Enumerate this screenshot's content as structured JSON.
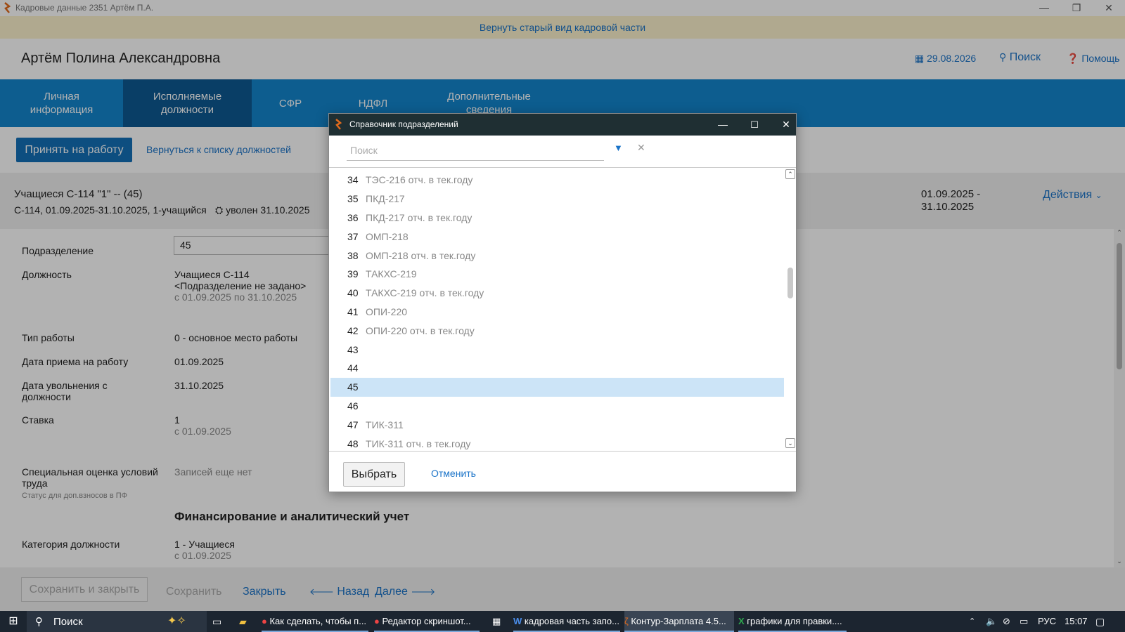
{
  "window": {
    "title": "Кадровые данные  2351  Артём П.А."
  },
  "banner": {
    "text": "Вернуть старый вид кадровой части"
  },
  "header": {
    "person_name": "Артём Полина Александровна",
    "date": "29.08.2026",
    "search": "Поиск",
    "help": "Помощь"
  },
  "tabs": [
    {
      "label_line1": "Личная",
      "label_line2": "информация"
    },
    {
      "label_line1": "Исполняемые",
      "label_line2": "должности"
    },
    {
      "label_line1": "СФР",
      "label_line2": ""
    },
    {
      "label_line1": "НДФЛ",
      "label_line2": ""
    },
    {
      "label_line1": "Дополнительные",
      "label_line2": "сведения"
    }
  ],
  "actions": {
    "hire": "Принять на работу",
    "back_to_list": "Вернуться к списку должностей"
  },
  "position": {
    "title": "Учащиеся С-114 \"1\" --  (45)",
    "details": "С-114, 01.09.2025-31.10.2025, 1-учащийся",
    "dismissed": "уволен 31.10.2025",
    "period_line1": "01.09.2025 -",
    "period_line2": "31.10.2025",
    "actions_menu": "Действия"
  },
  "form": {
    "department_label": "Подразделение",
    "department_value": "45",
    "position_label": "Должность",
    "position_value": "Учащиеся С-114",
    "position_dept": "<Подразделение не задано>",
    "position_period": "с 01.09.2025 по 31.10.2025",
    "work_type_label": "Тип работы",
    "work_type_value": "0 - основное место работы",
    "hire_date_label": "Дата приема на работу",
    "hire_date_value": "01.09.2025",
    "dismiss_date_label_1": "Дата увольнения с",
    "dismiss_date_label_2": "должности",
    "dismiss_date_value": "31.10.2025",
    "rate_label": "Ставка",
    "rate_value": "1",
    "rate_since": "с 01.09.2025",
    "special_label_1": "Специальная оценка условий",
    "special_label_2": "труда",
    "special_note": "Статус для доп.взносов в ПФ",
    "special_value": "Записей еще нет",
    "section_title": "Финансирование и аналитический учет",
    "category_label": "Категория должности",
    "category_value": "1 - Учащиеся",
    "category_since": "с 01.09.2025"
  },
  "footer": {
    "save_close": "Сохранить и закрыть",
    "save": "Сохранить",
    "close": "Закрыть",
    "back": "Назад",
    "next": "Далее"
  },
  "dialog": {
    "title": "Справочник подразделений",
    "search_placeholder": "Поиск",
    "rows": [
      {
        "num": "34",
        "name": "ТЭС-216 отч. в тек.году"
      },
      {
        "num": "35",
        "name": "ПКД-217"
      },
      {
        "num": "36",
        "name": "ПКД-217 отч. в тек.году"
      },
      {
        "num": "37",
        "name": "ОМП-218"
      },
      {
        "num": "38",
        "name": "ОМП-218 отч. в тек.году"
      },
      {
        "num": "39",
        "name": "ТАКХС-219"
      },
      {
        "num": "40",
        "name": "ТАКХС-219 отч. в тек.году"
      },
      {
        "num": "41",
        "name": "ОПИ-220"
      },
      {
        "num": "42",
        "name": "ОПИ-220 отч. в тек.году"
      },
      {
        "num": "43",
        "name": ""
      },
      {
        "num": "44",
        "name": ""
      },
      {
        "num": "45",
        "name": ""
      },
      {
        "num": "46",
        "name": ""
      },
      {
        "num": "47",
        "name": "ТИК-311"
      },
      {
        "num": "48",
        "name": "ТИК-311 отч. в тек.году"
      }
    ],
    "selected_num": "45",
    "select_btn": "Выбрать",
    "cancel_btn": "Отменить"
  },
  "taskbar": {
    "search": "Поиск",
    "items": [
      "Как сделать, чтобы п...",
      "Редактор скриншот...",
      "кадровая часть запо...",
      "Контур-Зарплата 4.5...",
      "графики для правки...."
    ],
    "lang": "РУС",
    "time": "15:07"
  },
  "colors": {
    "accent_blue": "#1486cd",
    "tab_active": "#0e5a93",
    "banner_bg": "#fdf3cd",
    "dialog_title_bg": "#1f2f33",
    "selection": "#cce4f7"
  }
}
